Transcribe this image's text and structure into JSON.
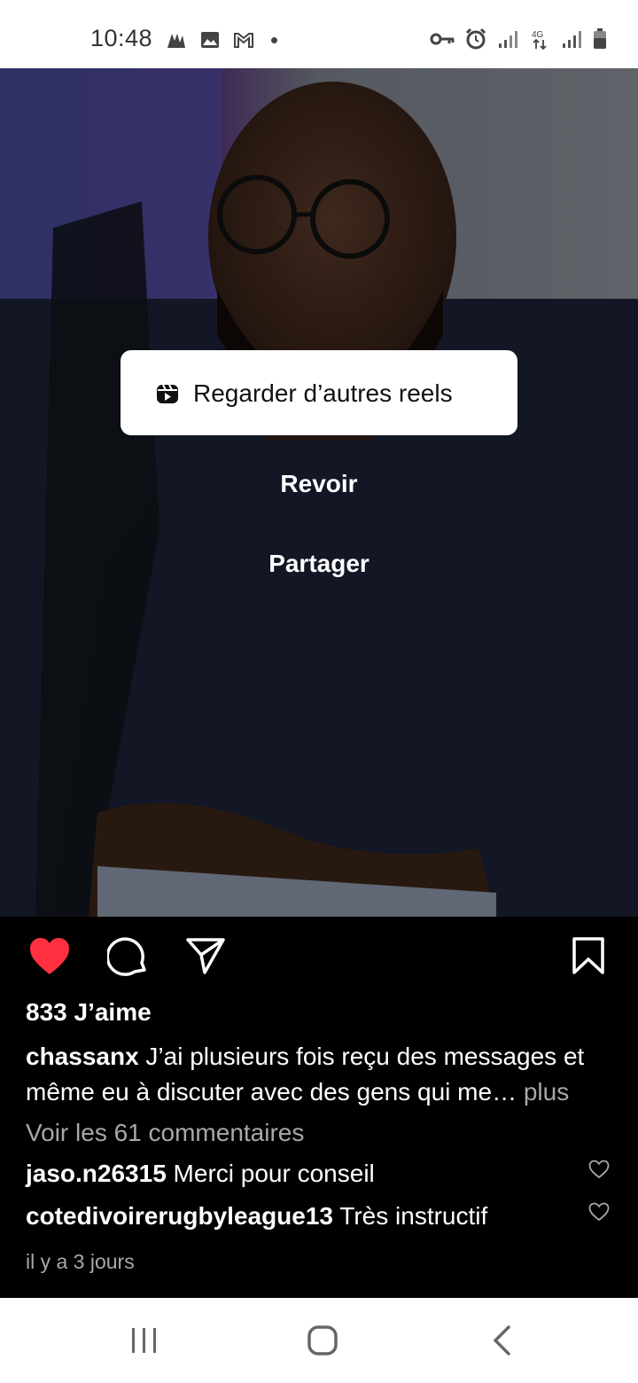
{
  "status_bar": {
    "time": "10:48",
    "left_icons": [
      "activity-icon",
      "gallery-icon",
      "gmail-icon",
      "notification-dot"
    ],
    "right_icons": [
      "vpn-key-icon",
      "alarm-icon",
      "signal-icon",
      "network-4g-icon",
      "signal-icon",
      "battery-icon"
    ],
    "network_label": "4G"
  },
  "overlay": {
    "watch_more_label": "Regarder d’autres reels",
    "replay_label": "Revoir",
    "share_label": "Partager"
  },
  "post": {
    "likes": "833 J’aime",
    "caption_username": "chassanx",
    "caption_text": " J’ai plusieurs fois reçu des messages et même eu à discuter avec des gens qui me",
    "caption_ellipsis": "…",
    "caption_more": " plus",
    "view_comments": "Voir les 61 commentaires",
    "comments": [
      {
        "username": "jaso.n26315",
        "text": " Merci pour conseil"
      },
      {
        "username": "cotedivoirerugbyleague13",
        "text": " Très instructif"
      }
    ],
    "timestamp": "il y a 3 jours",
    "liked": true
  },
  "colors": {
    "like_red": "#ff3040",
    "muted_text": "#a8a8a8",
    "background": "#000000"
  }
}
